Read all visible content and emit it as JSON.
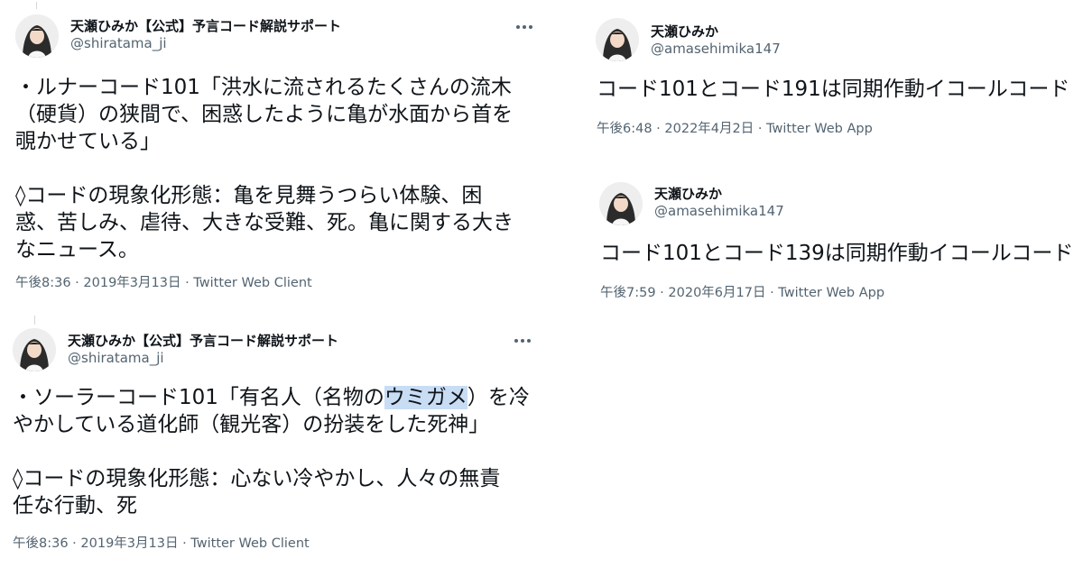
{
  "tweets": [
    {
      "name": "天瀬ひみか【公式】予言コード解説サポート",
      "handle": "@shiratama_ji",
      "body": {
        "line1": "・ルナーコード101「洪水に流されるたくさんの流木",
        "line2": "（硬貨）の狭間で、困惑したように亀が水面から首を",
        "line3": "覗かせている」",
        "line4": "◊コードの現象化形態：亀を見舞うつらい体験、困",
        "line5": "惑、苦しみ、虐待、大きな受難、死。亀に関する大き",
        "line6": "なニュース。"
      },
      "meta": "午後8:36 · 2019年3月13日 · Twitter Web Client"
    },
    {
      "name": "天瀬ひみか【公式】予言コード解説サポート",
      "handle": "@shiratama_ji",
      "body": {
        "line1_pre": "・ソーラーコード101「有名人（名物の",
        "line1_hl": "ウミガメ",
        "line1_post": "）を冷",
        "line2": "やかしている道化師（観光客）の扮装をした死神」",
        "line3": "◊コードの現象化形態：心ない冷やかし、人々の無責",
        "line4": "任な行動、死"
      },
      "meta": "午後8:36 · 2019年3月13日 · Twitter Web Client"
    },
    {
      "name": "天瀬ひみか",
      "handle": "@amasehimika147",
      "body": {
        "line1": "コード101とコード191は同期作動イコールコード"
      },
      "meta": "午後6:48 · 2022年4月2日 · Twitter Web App"
    },
    {
      "name": "天瀬ひみか",
      "handle": "@amasehimika147",
      "body": {
        "line1": "コード101とコード139は同期作動イコールコード"
      },
      "meta": "午後7:59 · 2020年6月17日 · Twitter Web App"
    }
  ],
  "icons": {
    "avatar": "avatar-icon",
    "more": "more-options-icon"
  },
  "colors": {
    "text": "#0f1419",
    "secondary": "#536471",
    "highlight": "#c8dcf4",
    "divider": "#cfd9de"
  }
}
